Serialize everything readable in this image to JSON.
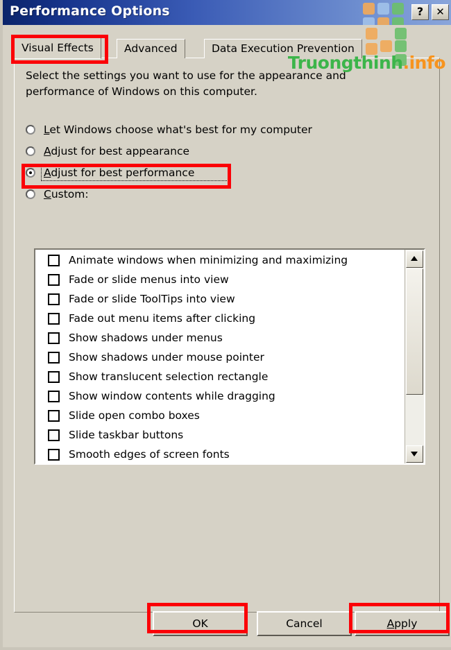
{
  "window": {
    "title": "Performance Options",
    "help_button": "?",
    "close_button": "✕",
    "help_icon_name": "help-icon",
    "close_icon_name": "close-icon"
  },
  "colors": {
    "title_gradient_start": "#0a246a",
    "title_gradient_end": "#8aa6db",
    "dialog_face": "#d6d2c6",
    "annotation_red": "#fb0007",
    "watermark_green": "#3cb54a",
    "watermark_orange": "#f7941e",
    "deco_orange": "#f0a95a",
    "deco_green": "#6dbf6d",
    "deco_blue": "#9fc0e8"
  },
  "tabs": [
    {
      "label": "Visual Effects",
      "active": true,
      "highlighted": true
    },
    {
      "label": "Advanced",
      "active": false,
      "highlighted": false
    },
    {
      "label": "Data Execution Prevention",
      "active": false,
      "highlighted": false
    }
  ],
  "description": "Select the settings you want to use for the appearance and performance of Windows on this computer.",
  "radio_options": [
    {
      "pre": "",
      "accel": "L",
      "post": "et Windows choose what's best for my computer",
      "full": "Let Windows choose what's best for my computer",
      "checked": false,
      "focused": false,
      "highlighted": false,
      "name": "radio-let-windows-choose"
    },
    {
      "pre": "",
      "accel": "A",
      "post": "djust for best appearance",
      "full": "Adjust for best appearance",
      "checked": false,
      "focused": false,
      "highlighted": false,
      "name": "radio-adjust-best-appearance"
    },
    {
      "pre": "",
      "accel": "A",
      "post": "djust for best performance",
      "full": "Adjust for best performance",
      "checked": true,
      "focused": true,
      "highlighted": true,
      "name": "radio-adjust-best-performance"
    },
    {
      "pre": "",
      "accel": "C",
      "post": "ustom:",
      "full": "Custom:",
      "checked": false,
      "focused": false,
      "highlighted": false,
      "name": "radio-custom"
    }
  ],
  "effects_list": [
    {
      "label": "Animate windows when minimizing and maximizing",
      "checked": false
    },
    {
      "label": "Fade or slide menus into view",
      "checked": false
    },
    {
      "label": "Fade or slide ToolTips into view",
      "checked": false
    },
    {
      "label": "Fade out menu items after clicking",
      "checked": false
    },
    {
      "label": "Show shadows under menus",
      "checked": false
    },
    {
      "label": "Show shadows under mouse pointer",
      "checked": false
    },
    {
      "label": "Show translucent selection rectangle",
      "checked": false
    },
    {
      "label": "Show window contents while dragging",
      "checked": false
    },
    {
      "label": "Slide open combo boxes",
      "checked": false
    },
    {
      "label": "Slide taskbar buttons",
      "checked": false
    },
    {
      "label": "Smooth edges of screen fonts",
      "checked": false
    }
  ],
  "scrollbar": {
    "up_arrow": "▲",
    "down_arrow": "▼",
    "thumb_position_percent": 0,
    "thumb_size_percent": 65
  },
  "buttons": [
    {
      "label": "OK",
      "pre": "OK",
      "accel": "",
      "post": "",
      "highlighted": true,
      "name": "ok-button"
    },
    {
      "label": "Cancel",
      "pre": "Cancel",
      "accel": "",
      "post": "",
      "highlighted": false,
      "name": "cancel-button"
    },
    {
      "label": "Apply",
      "pre": "",
      "accel": "A",
      "post": "pply",
      "highlighted": true,
      "name": "apply-button"
    }
  ],
  "watermark": {
    "name": "Truongthinh",
    "dot": ".",
    "tld": "info"
  }
}
